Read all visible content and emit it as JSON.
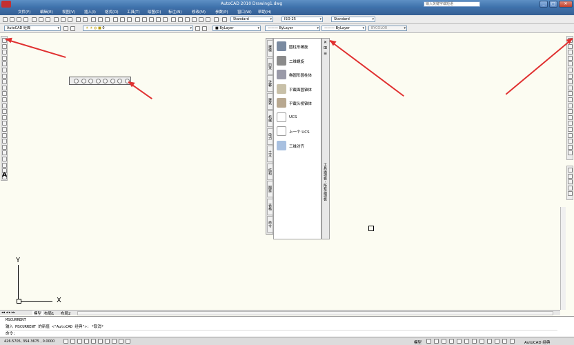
{
  "window": {
    "title": "AutoCAD 2010  Drawing1.dwg",
    "search_placeholder": "输入关键字或短语"
  },
  "menu": [
    "文件(F)",
    "编辑(E)",
    "视图(V)",
    "插入(I)",
    "格式(O)",
    "工具(T)",
    "绘图(D)",
    "标注(N)",
    "修改(M)",
    "参数(P)",
    "窗口(W)",
    "帮助(H)"
  ],
  "toolbar_row1": {
    "text_style": "Standard",
    "dim_style": "ISO-25",
    "table_style": "Standard"
  },
  "toolbar_row2": {
    "workspace": "AutoCAD 经典",
    "layer": "0",
    "color": "ByLayer",
    "linetype": "ByLayer",
    "lineweight": "ByLayer",
    "plotstyle": "BYCOLOR"
  },
  "tool_palette": {
    "title": "工具选项板 - 所有选项板",
    "items": [
      "圆柱形螺旋",
      "二维螺旋",
      "椭圆形圆柱体",
      "平截面圆锥体",
      "平截头棱锥体",
      "UCS",
      "上一个 UCS",
      "三维对齐"
    ],
    "tabs": [
      "建模",
      "约束",
      "注释",
      "建筑",
      "机械",
      "电力",
      "土木",
      "结构",
      "图案",
      "表格",
      "命令"
    ]
  },
  "ucs": {
    "x_label": "X",
    "y_label": "Y"
  },
  "layout_tabs": [
    "模型",
    "布局1",
    "布局2"
  ],
  "command": {
    "line1": "MSCURRENT",
    "line2": "输入 MSCURRENT 的新值 <\"AutoCAD 经典\">: *取消*",
    "prompt": "命令:"
  },
  "status": {
    "coords": "426.5705, 354.3675 , 0.0000",
    "model": "模型",
    "workspace": "AutoCAD 经典"
  },
  "colors": {
    "annotation_arrow": "#e03030",
    "title_bar": "#3a6ea8"
  }
}
